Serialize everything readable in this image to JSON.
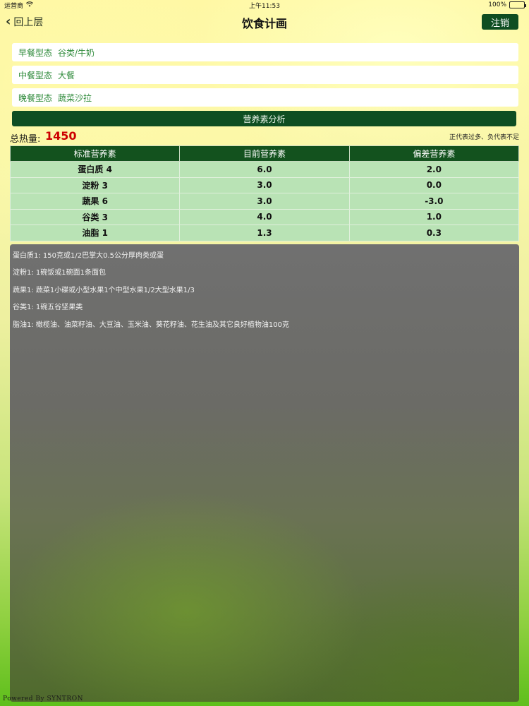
{
  "status_bar": {
    "carrier": "运营商",
    "time": "上午11:53",
    "battery_percent": "100%",
    "battery_level": 1.0,
    "wifi_icon": "wifi-icon"
  },
  "nav": {
    "back_label": "回上层",
    "title": "饮食计画",
    "logout_label": "注销"
  },
  "meals": [
    {
      "label": "早餐型态",
      "value": "谷类/牛奶"
    },
    {
      "label": "中餐型态",
      "value": "大餐"
    },
    {
      "label": "晚餐型态",
      "value": "蔬菜沙拉"
    }
  ],
  "analyze_label": "营养素分析",
  "calories": {
    "label": "总热量:",
    "value": "1450",
    "note": "正代表过多、负代表不足"
  },
  "table": {
    "headers": [
      "标准营养素",
      "目前营养素",
      "偏差营养素"
    ],
    "rows": [
      [
        "蛋白质 4",
        "6.0",
        "2.0"
      ],
      [
        "淀粉 3",
        "3.0",
        "0.0"
      ],
      [
        "蔬果 6",
        "3.0",
        "-3.0"
      ],
      [
        "谷类 3",
        "4.0",
        "1.0"
      ],
      [
        "油脂 1",
        "1.3",
        "0.3"
      ]
    ]
  },
  "info_lines": [
    "蛋白质1:  150克或1/2巴掌大0.5公分厚肉类或蛋",
    "淀粉1:  1碗饭或1碗面1条面包",
    "蔬果1:  蔬菜1小碟或小型水果1个中型水果1/2大型水果1/3",
    "谷类1:  1碗五谷坚果类",
    "脂油1:  橄榄油、油菜籽油、大豆油、玉米油、葵花籽油、花生油及其它良好植物油100克"
  ],
  "footer": "Powered By SYNTRON"
}
